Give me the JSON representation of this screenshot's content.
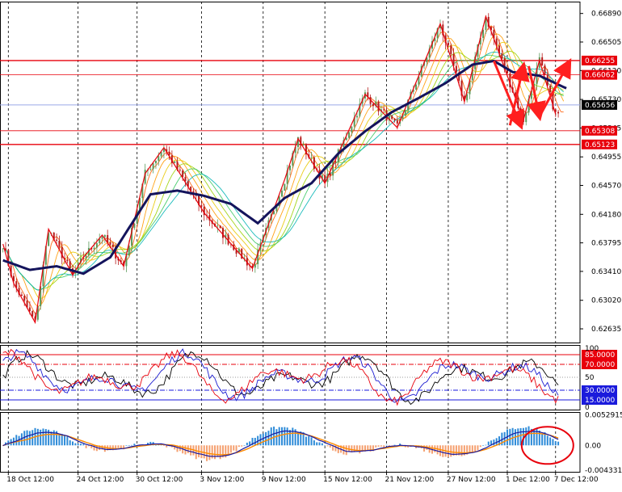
{
  "chart_data": [
    {
      "type": "candlestick",
      "x_ticks": [
        "18 Oct 12:00",
        "24 Oct 12:00",
        "30 Oct 12:00",
        "3 Nov 12:00",
        "9 Nov 12:00",
        "15 Nov 12:00",
        "21 Nov 12:00",
        "27 Nov 12:00",
        "1 Dec 12:00",
        "7 Dec 12:00"
      ],
      "y_ticks": [
        "0.66890",
        "0.66505",
        "0.66120",
        "0.65730",
        "0.65345",
        "0.64955",
        "0.64570",
        "0.64180",
        "0.63795",
        "0.63410",
        "0.63020",
        "0.62635"
      ],
      "ylim": [
        0.6245,
        0.6705
      ],
      "price_lines": [
        {
          "label": "0.66255",
          "value": 0.66255,
          "style": "solid",
          "color": "#e8000b"
        },
        {
          "label": "0.66062",
          "value": 0.66062,
          "style": "solid",
          "color": "#e8000b"
        },
        {
          "label": "0.65656",
          "value": 0.65656,
          "style": "current",
          "color": "#000000"
        },
        {
          "label": "0.65308",
          "value": 0.65308,
          "style": "solid",
          "color": "#e8000b"
        },
        {
          "label": "0.65123",
          "value": 0.65123,
          "style": "solid",
          "color": "#e8000b"
        }
      ],
      "zigzag": [
        [
          0,
          0.6378
        ],
        [
          4,
          0.6325
        ],
        [
          12,
          0.6272
        ],
        [
          17,
          0.6398
        ],
        [
          26,
          0.6336
        ],
        [
          30,
          0.636
        ],
        [
          37,
          0.639
        ],
        [
          45,
          0.6348
        ],
        [
          53,
          0.6473
        ],
        [
          60,
          0.6508
        ],
        [
          75,
          0.642
        ],
        [
          93,
          0.6345
        ],
        [
          105,
          0.6465
        ],
        [
          110,
          0.652
        ],
        [
          120,
          0.646
        ],
        [
          135,
          0.658
        ],
        [
          147,
          0.6535
        ],
        [
          163,
          0.6675
        ],
        [
          172,
          0.657
        ],
        [
          180,
          0.6685
        ],
        [
          194,
          0.6545
        ],
        [
          200,
          0.6626
        ],
        [
          206,
          0.6553
        ]
      ],
      "slow_ma": [
        [
          0,
          0.6356
        ],
        [
          10,
          0.6343
        ],
        [
          20,
          0.6348
        ],
        [
          30,
          0.6338
        ],
        [
          40,
          0.636
        ],
        [
          55,
          0.6445
        ],
        [
          65,
          0.645
        ],
        [
          75,
          0.6443
        ],
        [
          85,
          0.6432
        ],
        [
          95,
          0.6406
        ],
        [
          105,
          0.644
        ],
        [
          115,
          0.646
        ],
        [
          125,
          0.65
        ],
        [
          135,
          0.653
        ],
        [
          145,
          0.6556
        ],
        [
          155,
          0.6575
        ],
        [
          165,
          0.6595
        ],
        [
          175,
          0.662
        ],
        [
          183,
          0.6625
        ],
        [
          190,
          0.661
        ],
        [
          200,
          0.6605
        ],
        [
          210,
          0.6588
        ]
      ],
      "arrows": [
        [
          [
            183,
            0.6625
          ],
          [
            193,
            0.6538
          ]
        ],
        [
          [
            189,
            0.6538
          ],
          [
            194,
            0.6618
          ]
        ],
        [
          [
            196,
            0.6618
          ],
          [
            200,
            0.655
          ]
        ],
        [
          [
            200,
            0.655
          ],
          [
            211,
            0.6623
          ]
        ]
      ],
      "colors": {
        "up": "#5a9a5a",
        "down": "#b51c1c",
        "zigzag": "#e8000b",
        "slow_ma": "#14145c",
        "arrow": "#ff1f1f",
        "ribbon": [
          "#ff5a00",
          "#ff9900",
          "#e8c800",
          "#9ad000",
          "#38c860",
          "#00b4b4"
        ]
      }
    },
    {
      "type": "line",
      "y_ticks": [
        "100",
        "85.0000",
        "70.0000",
        "50",
        "30.0000",
        "15.0000",
        "0"
      ],
      "ylim": [
        0,
        100
      ],
      "levels": [
        {
          "label": "85.0000",
          "value": 85,
          "style": "solid",
          "color": "#e8000b"
        },
        {
          "label": "70.0000",
          "value": 70,
          "style": "dashdot",
          "color": "#e8000b"
        },
        {
          "label": "50",
          "value": 50,
          "style": "dot",
          "color": "#999999"
        },
        {
          "label": "30.0000",
          "value": 30,
          "style": "dashdot",
          "color": "#1a1adc"
        },
        {
          "label": "15.0000",
          "value": 15,
          "style": "solid",
          "color": "#1a1adc"
        }
      ],
      "series_colors": [
        "#000000",
        "#1a1ad0",
        "#e8000b"
      ]
    },
    {
      "type": "bar",
      "y_ticks": [
        "0.0052915",
        "0.00",
        "-0.0043313"
      ],
      "ylim": [
        -0.0046,
        0.0058
      ],
      "colors": {
        "positive": "#2e8bd8",
        "negative": "#f5a070",
        "signal": "#ff8a00",
        "macd_line": "#1a1aa0",
        "ellipse": "#e8000b"
      }
    }
  ]
}
